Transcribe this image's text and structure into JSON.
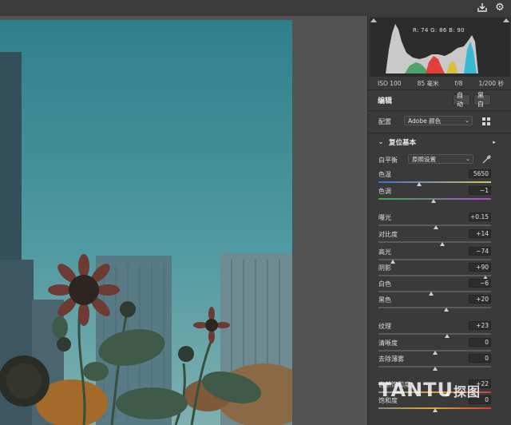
{
  "toolbar": {
    "export_icon": "export-icon",
    "settings_icon": "gear-icon"
  },
  "histogram": {
    "readout": "R: 74   G: 86   B: 90"
  },
  "exif": {
    "iso": "ISO 100",
    "focal": "85 毫米",
    "aperture": "f/8",
    "shutter": "1/200 秒"
  },
  "edit": {
    "title": "编辑",
    "auto_label": "自动",
    "bw_label": "黑白",
    "profile_label": "配置",
    "profile_value": "Adobe 颜色",
    "browse_icon": "grid-icon"
  },
  "basic": {
    "title": "复位基本",
    "wb_label": "白平衡",
    "wb_value": "原照设置",
    "eyedropper_icon": "eyedropper-icon"
  },
  "sliders": [
    {
      "label": "色温",
      "value": "5650",
      "level": 0.36
    },
    {
      "label": "色调",
      "value": "−1",
      "level": 0.49
    },
    {
      "label": "曝光",
      "value": "+0.15",
      "level": 0.51
    },
    {
      "label": "对比度",
      "value": "+14",
      "level": 0.57
    },
    {
      "label": "高光",
      "value": "−74",
      "level": 0.13
    },
    {
      "label": "阴影",
      "value": "+90",
      "level": 0.95
    },
    {
      "label": "白色",
      "value": "−6",
      "level": 0.47
    },
    {
      "label": "黑色",
      "value": "+20",
      "level": 0.6
    },
    {
      "label": "纹理",
      "value": "+23",
      "level": 0.61
    },
    {
      "label": "清晰度",
      "value": "0",
      "level": 0.5
    },
    {
      "label": "去除薄雾",
      "value": "0",
      "level": 0.5
    },
    {
      "label": "自然饱和度",
      "value": "+22",
      "level": 0.61
    },
    {
      "label": "饱和度",
      "value": "0",
      "level": 0.5
    }
  ],
  "watermark": {
    "brand": "TANTU",
    "suffix": "探图"
  }
}
